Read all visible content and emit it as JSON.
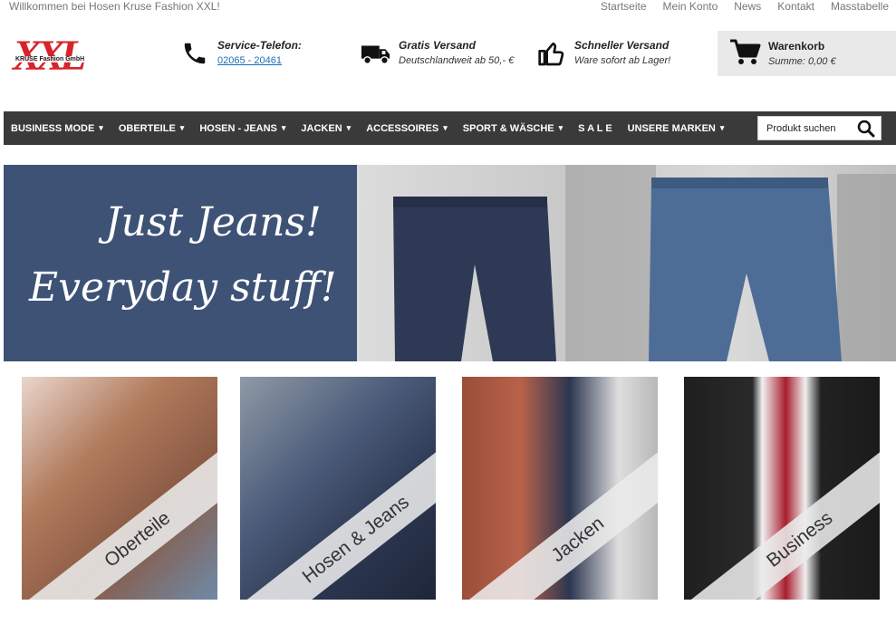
{
  "topbar": {
    "welcome": "Willkommen bei Hosen Kruse Fashion XXL!",
    "links": [
      "Startseite",
      "Mein Konto",
      "News",
      "Kontakt",
      "Masstabelle"
    ]
  },
  "logo": {
    "mark": "XXL",
    "sub": "KRUSE Fashion GmbH"
  },
  "service": {
    "title": "Service-Telefon:",
    "phone": "02065 - 20461"
  },
  "shipping": {
    "title": "Gratis Versand",
    "subtitle": "Deutschlandweit ab 50,- €"
  },
  "fast": {
    "title": "Schneller Versand",
    "subtitle": "Ware sofort ab Lager!"
  },
  "cart": {
    "title": "Warenkorb",
    "sum": "Summe: 0,00 €"
  },
  "nav": {
    "items": [
      {
        "label": "BUSINESS MODE",
        "chevron": true
      },
      {
        "label": "OBERTEILE",
        "chevron": true
      },
      {
        "label": "HOSEN - JEANS",
        "chevron": true
      },
      {
        "label": "JACKEN",
        "chevron": true
      },
      {
        "label": "ACCESSOIRES",
        "chevron": true
      },
      {
        "label": "SPORT & WÄSCHE",
        "chevron": true
      },
      {
        "label": "S A L E",
        "chevron": false
      },
      {
        "label": "UNSERE MARKEN",
        "chevron": true
      }
    ],
    "search_placeholder": "Produkt suchen"
  },
  "hero": {
    "line1": "Just Jeans!",
    "line2": "Everyday stuff!"
  },
  "categories": [
    {
      "label": "Oberteile",
      "bg": "#a86a4a"
    },
    {
      "label": "Hosen & Jeans",
      "bg": "#3b4a66"
    },
    {
      "label": "Jacken",
      "bg": "#8c4a38"
    },
    {
      "label": "Business",
      "bg": "#2a2a2a"
    }
  ],
  "colors": {
    "nav_bg": "#3a3a3a",
    "hero_blue": "#3d5275",
    "accent": "#d8232a",
    "link": "#1a6fb5"
  },
  "icons": [
    "phone-icon",
    "truck-icon",
    "thumbs-up-icon",
    "cart-icon",
    "search-icon",
    "chevron-down-icon"
  ]
}
